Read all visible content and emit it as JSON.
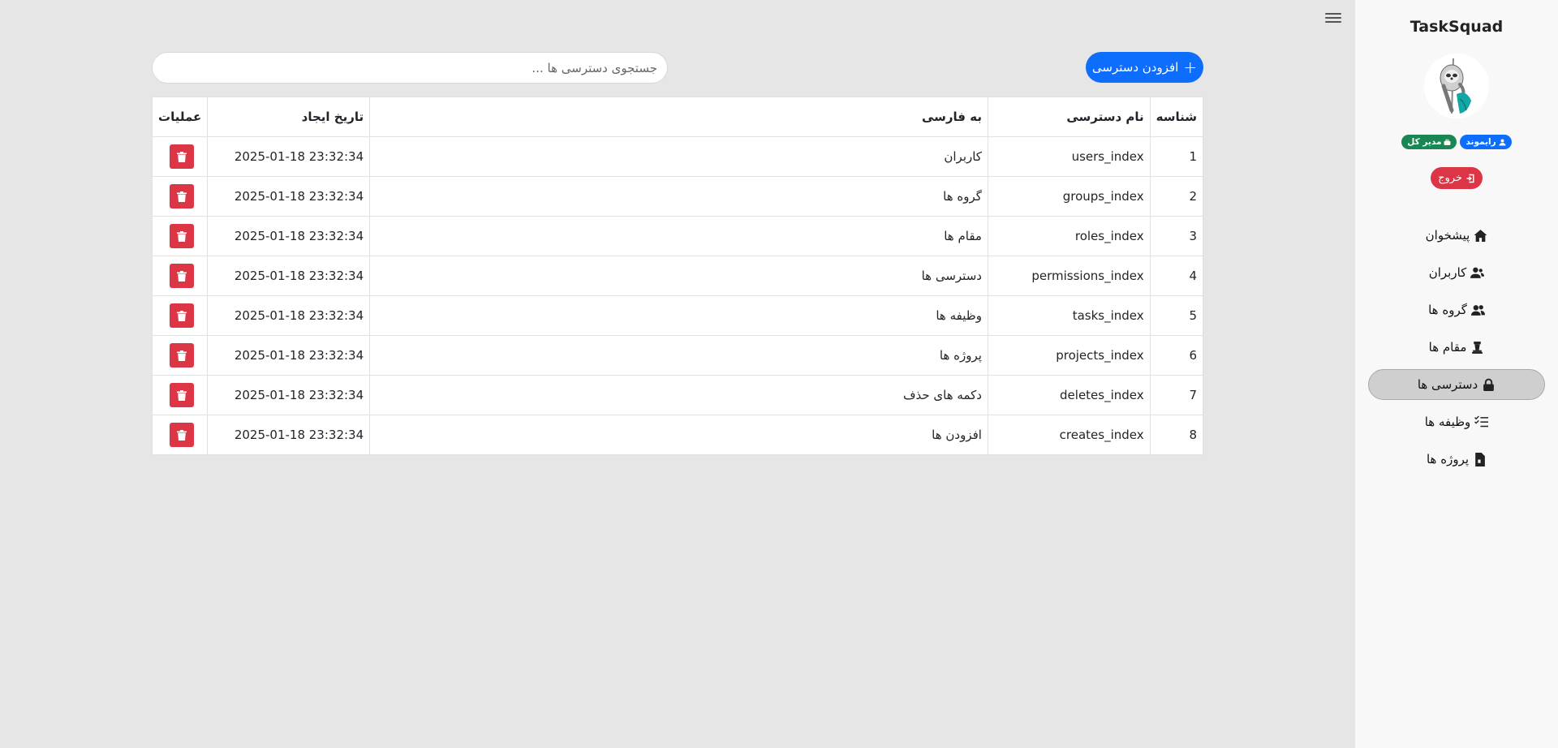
{
  "app": {
    "brand": "TaskSquad"
  },
  "sidebar": {
    "user_badge": "رایموند",
    "role_badge": "مدیر کل",
    "logout_label": "خروج",
    "items": [
      {
        "label": "پیشخوان",
        "icon": "home-icon",
        "active": false
      },
      {
        "label": "کاربران",
        "icon": "users-icon",
        "active": false
      },
      {
        "label": "گروه ها",
        "icon": "group-icon",
        "active": false
      },
      {
        "label": "مقام ها",
        "icon": "chess-piece-icon",
        "active": false
      },
      {
        "label": "دسترسی ها",
        "icon": "lock-icon",
        "active": true
      },
      {
        "label": "وظیفه ها",
        "icon": "checklist-icon",
        "active": false
      },
      {
        "label": "پروژه ها",
        "icon": "file-icon",
        "active": false
      }
    ]
  },
  "toolbar": {
    "add_label": "افزودن دسترسی",
    "search_placeholder": "جستجوی دسترسی ها ..."
  },
  "table": {
    "headers": {
      "id": "شناسه",
      "name": "نام دسترسی",
      "fa": "به فارسی",
      "created": "تاریخ ایجاد",
      "ops": "عملیات"
    },
    "rows": [
      {
        "id": "1",
        "name": "users_index",
        "fa": "کاربران",
        "created": "2025-01-18 23:32:34"
      },
      {
        "id": "2",
        "name": "groups_index",
        "fa": "گروه ها",
        "created": "2025-01-18 23:32:34"
      },
      {
        "id": "3",
        "name": "roles_index",
        "fa": "مقام ها",
        "created": "2025-01-18 23:32:34"
      },
      {
        "id": "4",
        "name": "permissions_index",
        "fa": "دسترسی ها",
        "created": "2025-01-18 23:32:34"
      },
      {
        "id": "5",
        "name": "tasks_index",
        "fa": "وظیفه ها",
        "created": "2025-01-18 23:32:34"
      },
      {
        "id": "6",
        "name": "projects_index",
        "fa": "پروژه ها",
        "created": "2025-01-18 23:32:34"
      },
      {
        "id": "7",
        "name": "deletes_index",
        "fa": "دکمه های حذف",
        "created": "2025-01-18 23:32:34"
      },
      {
        "id": "8",
        "name": "creates_index",
        "fa": "افزودن ها",
        "created": "2025-01-18 23:32:34"
      }
    ]
  },
  "colors": {
    "primary": "#0d6efd",
    "danger": "#dc3545",
    "success": "#198754",
    "background": "#e6e6e6",
    "sidebar": "#f8f8f8"
  }
}
